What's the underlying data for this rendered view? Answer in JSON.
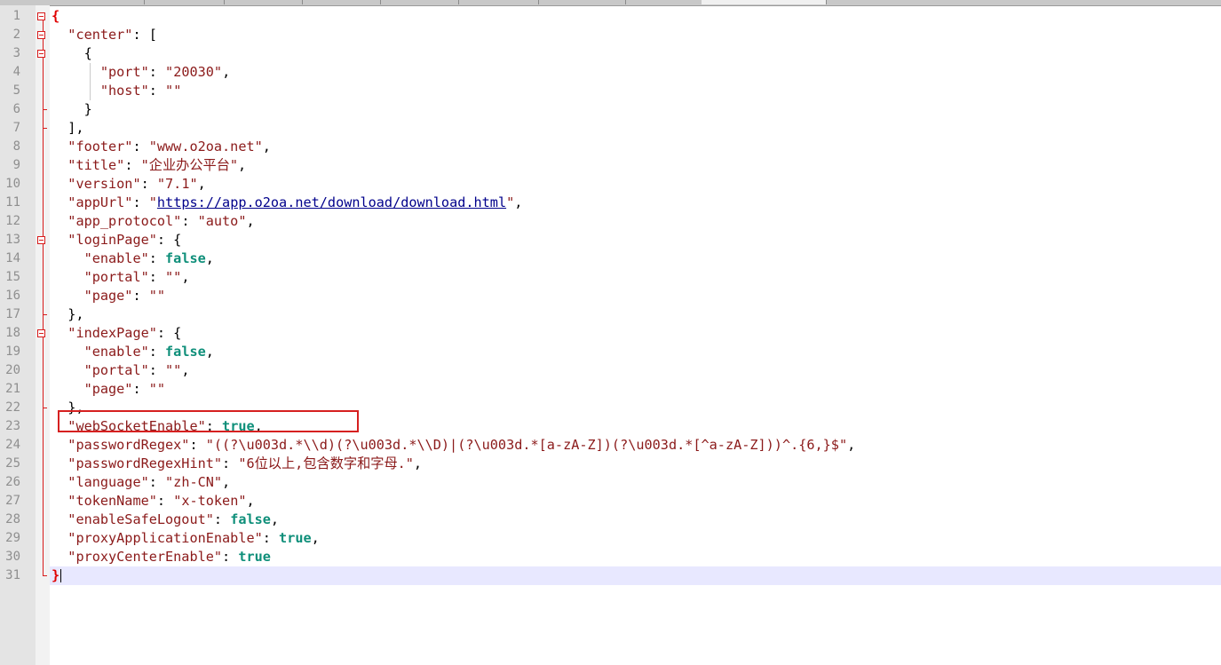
{
  "editor": {
    "lines": [
      {
        "num": "1",
        "parts": [
          {
            "t": "{",
            "c": "brace"
          }
        ]
      },
      {
        "num": "2",
        "parts": [
          {
            "t": "  ",
            "c": "p"
          },
          {
            "t": "\"center\"",
            "c": "k"
          },
          {
            "t": ": [",
            "c": "p"
          }
        ]
      },
      {
        "num": "3",
        "parts": [
          {
            "t": "    {",
            "c": "p"
          }
        ]
      },
      {
        "num": "4",
        "parts": [
          {
            "t": "      ",
            "c": "p"
          },
          {
            "t": "\"port\"",
            "c": "k"
          },
          {
            "t": ": ",
            "c": "p"
          },
          {
            "t": "\"20030\"",
            "c": "k"
          },
          {
            "t": ",",
            "c": "p"
          }
        ]
      },
      {
        "num": "5",
        "parts": [
          {
            "t": "      ",
            "c": "p"
          },
          {
            "t": "\"host\"",
            "c": "k"
          },
          {
            "t": ": ",
            "c": "p"
          },
          {
            "t": "\"\"",
            "c": "k"
          }
        ]
      },
      {
        "num": "6",
        "parts": [
          {
            "t": "    }",
            "c": "p"
          }
        ]
      },
      {
        "num": "7",
        "parts": [
          {
            "t": "  ],",
            "c": "p"
          }
        ]
      },
      {
        "num": "8",
        "parts": [
          {
            "t": "  ",
            "c": "p"
          },
          {
            "t": "\"footer\"",
            "c": "k"
          },
          {
            "t": ": ",
            "c": "p"
          },
          {
            "t": "\"www.o2oa.net\"",
            "c": "k"
          },
          {
            "t": ",",
            "c": "p"
          }
        ]
      },
      {
        "num": "9",
        "parts": [
          {
            "t": "  ",
            "c": "p"
          },
          {
            "t": "\"title\"",
            "c": "k"
          },
          {
            "t": ": ",
            "c": "p"
          },
          {
            "t": "\"企业办公平台\"",
            "c": "k"
          },
          {
            "t": ",",
            "c": "p"
          }
        ]
      },
      {
        "num": "10",
        "parts": [
          {
            "t": "  ",
            "c": "p"
          },
          {
            "t": "\"version\"",
            "c": "k"
          },
          {
            "t": ": ",
            "c": "p"
          },
          {
            "t": "\"7.1\"",
            "c": "k"
          },
          {
            "t": ",",
            "c": "p"
          }
        ]
      },
      {
        "num": "11",
        "parts": [
          {
            "t": "  ",
            "c": "p"
          },
          {
            "t": "\"appUrl\"",
            "c": "k"
          },
          {
            "t": ": ",
            "c": "p"
          },
          {
            "t": "\"",
            "c": "k"
          },
          {
            "t": "https://app.o2oa.net/download/download.html",
            "c": "lnk"
          },
          {
            "t": "\"",
            "c": "k"
          },
          {
            "t": ",",
            "c": "p"
          }
        ]
      },
      {
        "num": "12",
        "parts": [
          {
            "t": "  ",
            "c": "p"
          },
          {
            "t": "\"app_protocol\"",
            "c": "k"
          },
          {
            "t": ": ",
            "c": "p"
          },
          {
            "t": "\"auto\"",
            "c": "k"
          },
          {
            "t": ",",
            "c": "p"
          }
        ]
      },
      {
        "num": "13",
        "parts": [
          {
            "t": "  ",
            "c": "p"
          },
          {
            "t": "\"loginPage\"",
            "c": "k"
          },
          {
            "t": ": {",
            "c": "p"
          }
        ]
      },
      {
        "num": "14",
        "parts": [
          {
            "t": "    ",
            "c": "p"
          },
          {
            "t": "\"enable\"",
            "c": "k"
          },
          {
            "t": ": ",
            "c": "p"
          },
          {
            "t": "false",
            "c": "b"
          },
          {
            "t": ",",
            "c": "p"
          }
        ]
      },
      {
        "num": "15",
        "parts": [
          {
            "t": "    ",
            "c": "p"
          },
          {
            "t": "\"portal\"",
            "c": "k"
          },
          {
            "t": ": ",
            "c": "p"
          },
          {
            "t": "\"\"",
            "c": "k"
          },
          {
            "t": ",",
            "c": "p"
          }
        ]
      },
      {
        "num": "16",
        "parts": [
          {
            "t": "    ",
            "c": "p"
          },
          {
            "t": "\"page\"",
            "c": "k"
          },
          {
            "t": ": ",
            "c": "p"
          },
          {
            "t": "\"\"",
            "c": "k"
          }
        ]
      },
      {
        "num": "17",
        "parts": [
          {
            "t": "  },",
            "c": "p"
          }
        ]
      },
      {
        "num": "18",
        "parts": [
          {
            "t": "  ",
            "c": "p"
          },
          {
            "t": "\"indexPage\"",
            "c": "k"
          },
          {
            "t": ": {",
            "c": "p"
          }
        ]
      },
      {
        "num": "19",
        "parts": [
          {
            "t": "    ",
            "c": "p"
          },
          {
            "t": "\"enable\"",
            "c": "k"
          },
          {
            "t": ": ",
            "c": "p"
          },
          {
            "t": "false",
            "c": "b"
          },
          {
            "t": ",",
            "c": "p"
          }
        ]
      },
      {
        "num": "20",
        "parts": [
          {
            "t": "    ",
            "c": "p"
          },
          {
            "t": "\"portal\"",
            "c": "k"
          },
          {
            "t": ": ",
            "c": "p"
          },
          {
            "t": "\"\"",
            "c": "k"
          },
          {
            "t": ",",
            "c": "p"
          }
        ]
      },
      {
        "num": "21",
        "parts": [
          {
            "t": "    ",
            "c": "p"
          },
          {
            "t": "\"page\"",
            "c": "k"
          },
          {
            "t": ": ",
            "c": "p"
          },
          {
            "t": "\"\"",
            "c": "k"
          }
        ]
      },
      {
        "num": "22",
        "parts": [
          {
            "t": "  },",
            "c": "p"
          }
        ]
      },
      {
        "num": "23",
        "parts": [
          {
            "t": "  ",
            "c": "p"
          },
          {
            "t": "\"webSocketEnable\"",
            "c": "k"
          },
          {
            "t": ": ",
            "c": "p"
          },
          {
            "t": "true",
            "c": "b"
          },
          {
            "t": ",",
            "c": "p"
          }
        ]
      },
      {
        "num": "24",
        "parts": [
          {
            "t": "  ",
            "c": "p"
          },
          {
            "t": "\"passwordRegex\"",
            "c": "k"
          },
          {
            "t": ": ",
            "c": "p"
          },
          {
            "t": "\"((?\\u003d.*\\\\d)(?\\u003d.*\\\\D)|(?\\u003d.*[a-zA-Z])(?\\u003d.*[^a-zA-Z]))^.{6,}$\"",
            "c": "k"
          },
          {
            "t": ",",
            "c": "p"
          }
        ]
      },
      {
        "num": "25",
        "parts": [
          {
            "t": "  ",
            "c": "p"
          },
          {
            "t": "\"passwordRegexHint\"",
            "c": "k"
          },
          {
            "t": ": ",
            "c": "p"
          },
          {
            "t": "\"6位以上,包含数字和字母.\"",
            "c": "k"
          },
          {
            "t": ",",
            "c": "p"
          }
        ]
      },
      {
        "num": "26",
        "parts": [
          {
            "t": "  ",
            "c": "p"
          },
          {
            "t": "\"language\"",
            "c": "k"
          },
          {
            "t": ": ",
            "c": "p"
          },
          {
            "t": "\"zh-CN\"",
            "c": "k"
          },
          {
            "t": ",",
            "c": "p"
          }
        ]
      },
      {
        "num": "27",
        "parts": [
          {
            "t": "  ",
            "c": "p"
          },
          {
            "t": "\"tokenName\"",
            "c": "k"
          },
          {
            "t": ": ",
            "c": "p"
          },
          {
            "t": "\"x-token\"",
            "c": "k"
          },
          {
            "t": ",",
            "c": "p"
          }
        ]
      },
      {
        "num": "28",
        "parts": [
          {
            "t": "  ",
            "c": "p"
          },
          {
            "t": "\"enableSafeLogout\"",
            "c": "k"
          },
          {
            "t": ": ",
            "c": "p"
          },
          {
            "t": "false",
            "c": "b"
          },
          {
            "t": ",",
            "c": "p"
          }
        ]
      },
      {
        "num": "29",
        "parts": [
          {
            "t": "  ",
            "c": "p"
          },
          {
            "t": "\"proxyApplicationEnable\"",
            "c": "k"
          },
          {
            "t": ": ",
            "c": "p"
          },
          {
            "t": "true",
            "c": "b"
          },
          {
            "t": ",",
            "c": "p"
          }
        ]
      },
      {
        "num": "30",
        "parts": [
          {
            "t": "  ",
            "c": "p"
          },
          {
            "t": "\"proxyCenterEnable\"",
            "c": "k"
          },
          {
            "t": ": ",
            "c": "p"
          },
          {
            "t": "true",
            "c": "b"
          }
        ]
      },
      {
        "num": "31",
        "parts": [
          {
            "t": "}",
            "c": "brace"
          }
        ]
      }
    ],
    "current_line": 31,
    "highlighted_line": 23,
    "fold_markers": [
      {
        "line": 1,
        "type": "open"
      },
      {
        "line": 2,
        "type": "open"
      },
      {
        "line": 3,
        "type": "open"
      },
      {
        "line": 6,
        "type": "end"
      },
      {
        "line": 7,
        "type": "end"
      },
      {
        "line": 13,
        "type": "open"
      },
      {
        "line": 17,
        "type": "end"
      },
      {
        "line": 18,
        "type": "open"
      },
      {
        "line": 22,
        "type": "end"
      },
      {
        "line": 31,
        "type": "end"
      }
    ],
    "colors": {
      "key": "#8b1a1a",
      "bool": "#0f8f7a",
      "link": "#00008b",
      "fold": "#d81b1b",
      "current_line_bg": "#e8e8ff",
      "highlight_box": "#d62020"
    }
  }
}
